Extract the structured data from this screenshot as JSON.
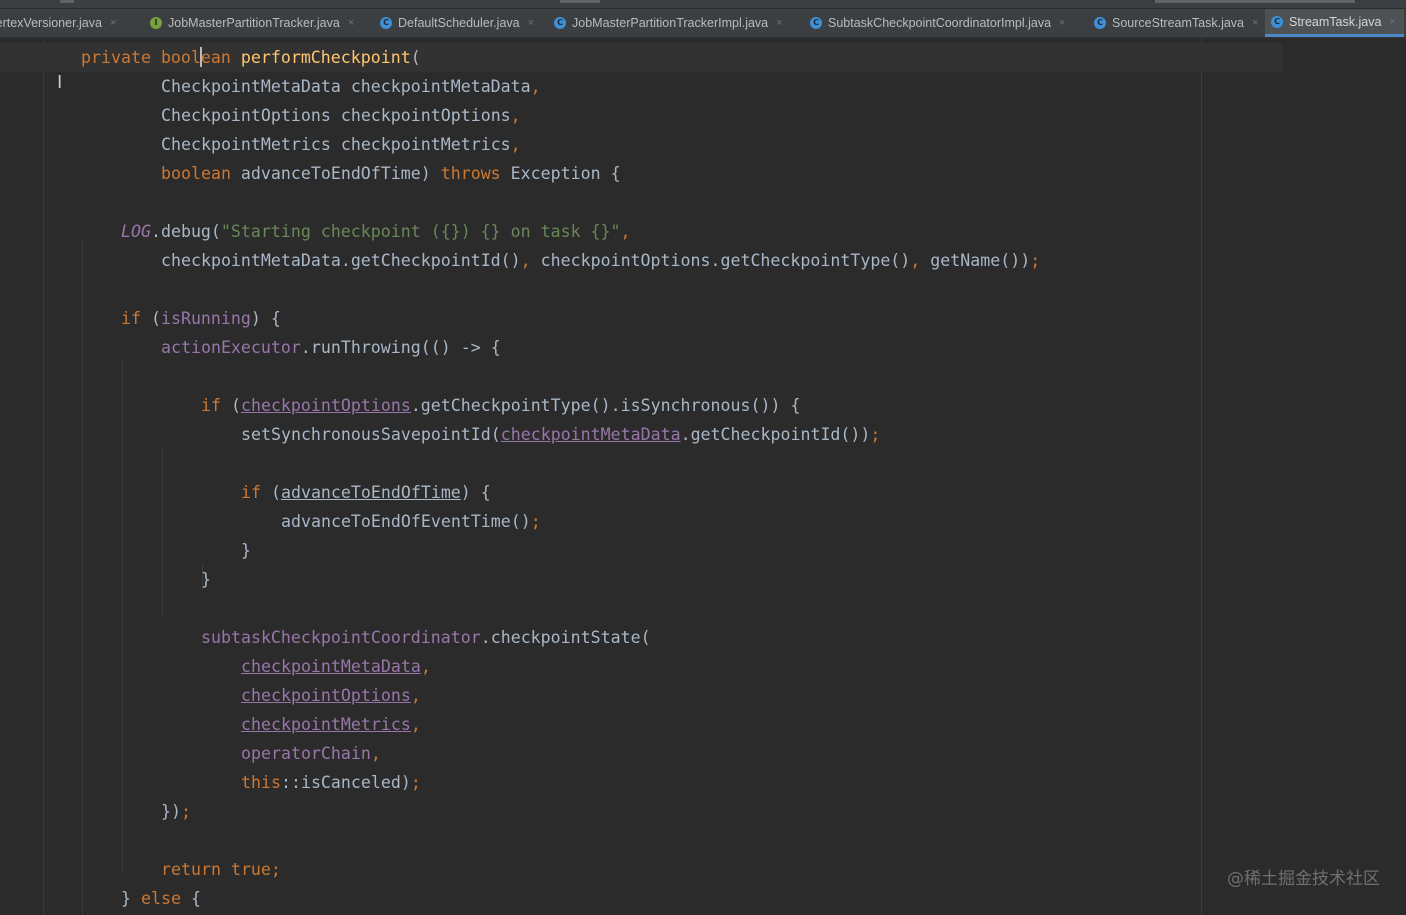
{
  "tabs": [
    {
      "label": "VertexVersioner.java",
      "icon": "class-icon",
      "active": false
    },
    {
      "label": "JobMasterPartitionTracker.java",
      "icon": "interface-icon",
      "active": false
    },
    {
      "label": "DefaultScheduler.java",
      "icon": "class-icon",
      "active": false
    },
    {
      "label": "JobMasterPartitionTrackerImpl.java",
      "icon": "class-icon",
      "active": false
    },
    {
      "label": "SubtaskCheckpointCoordinatorImpl.java",
      "icon": "class-icon",
      "active": false
    },
    {
      "label": "SourceStreamTask.java",
      "icon": "class-icon",
      "active": false
    },
    {
      "label": "StreamTask.java",
      "icon": "class-icon",
      "active": true
    }
  ],
  "tab_close_glyph": "×",
  "watermark": "@稀土掘金技术社区",
  "colors": {
    "keyword": "#cc7832",
    "method_decl": "#ffc66d",
    "string": "#6a8759",
    "field": "#9876aa",
    "plain": "#a9b7c6",
    "background": "#2b2b2b",
    "active_tab_underline": "#4a88c7"
  },
  "code_lines": [
    {
      "indent": 1,
      "tokens": [
        [
          "private",
          "kw"
        ],
        [
          " ",
          "pl"
        ],
        [
          "boolean",
          "kw"
        ],
        [
          " ",
          "pl"
        ],
        [
          "performCheckpoint",
          "fn"
        ],
        [
          "(",
          "pl"
        ]
      ]
    },
    {
      "indent": 3,
      "tokens": [
        [
          "CheckpointMetaData",
          "pl"
        ],
        [
          " checkpointMetaData",
          "pl"
        ],
        [
          ",",
          "pu"
        ]
      ]
    },
    {
      "indent": 3,
      "tokens": [
        [
          "CheckpointOptions",
          "pl"
        ],
        [
          " checkpointOptions",
          "pl"
        ],
        [
          ",",
          "pu"
        ]
      ]
    },
    {
      "indent": 3,
      "tokens": [
        [
          "CheckpointMetrics",
          "pl"
        ],
        [
          " checkpointMetrics",
          "pl"
        ],
        [
          ",",
          "pu"
        ]
      ]
    },
    {
      "indent": 3,
      "tokens": [
        [
          "boolean",
          "kw"
        ],
        [
          " advanceToEndOfTime) ",
          "pl"
        ],
        [
          "throws",
          "kw"
        ],
        [
          " Exception {",
          "pl"
        ]
      ]
    },
    {
      "indent": 0,
      "tokens": []
    },
    {
      "indent": 2,
      "tokens": [
        [
          "LOG",
          "logc"
        ],
        [
          ".debug(",
          "pl"
        ],
        [
          "\"Starting checkpoint ({}) {} on task {}\"",
          "str"
        ],
        [
          ",",
          "pu"
        ]
      ]
    },
    {
      "indent": 3,
      "tokens": [
        [
          "checkpointMetaData.getCheckpointId()",
          "pl"
        ],
        [
          ",",
          "pu"
        ],
        [
          " checkpointOptions.getCheckpointType()",
          "pl"
        ],
        [
          ",",
          "pu"
        ],
        [
          " getName())",
          "pl"
        ],
        [
          ";",
          "pu"
        ]
      ]
    },
    {
      "indent": 0,
      "tokens": []
    },
    {
      "indent": 2,
      "tokens": [
        [
          "if",
          "kw"
        ],
        [
          " (",
          "pl"
        ],
        [
          "isRunning",
          "field"
        ],
        [
          ") {",
          "pl"
        ]
      ]
    },
    {
      "indent": 3,
      "tokens": [
        [
          "actionExecutor",
          "field"
        ],
        [
          ".runThrowing(() -> {",
          "pl"
        ]
      ]
    },
    {
      "indent": 0,
      "tokens": []
    },
    {
      "indent": 4,
      "tokens": [
        [
          "if",
          "kw"
        ],
        [
          " (",
          "pl"
        ],
        [
          "checkpointOptions",
          "field u"
        ],
        [
          ".getCheckpointType().isSynchronous()) {",
          "pl"
        ]
      ]
    },
    {
      "indent": 5,
      "tokens": [
        [
          "setSynchronousSavepointId(",
          "pl"
        ],
        [
          "checkpointMetaData",
          "field u"
        ],
        [
          ".getCheckpointId())",
          "pl"
        ],
        [
          ";",
          "pu"
        ]
      ]
    },
    {
      "indent": 0,
      "tokens": []
    },
    {
      "indent": 5,
      "tokens": [
        [
          "if",
          "kw"
        ],
        [
          " (",
          "pl"
        ],
        [
          "advanceToEndOfTime",
          "pv"
        ],
        [
          ") {",
          "pl"
        ]
      ]
    },
    {
      "indent": 6,
      "tokens": [
        [
          "advanceToEndOfEventTime()",
          "pl"
        ],
        [
          ";",
          "pu"
        ]
      ]
    },
    {
      "indent": 5,
      "tokens": [
        [
          "}",
          "pl"
        ]
      ]
    },
    {
      "indent": 4,
      "tokens": [
        [
          "}",
          "pl"
        ]
      ]
    },
    {
      "indent": 0,
      "tokens": []
    },
    {
      "indent": 4,
      "tokens": [
        [
          "subtaskCheckpointCoordinator",
          "field"
        ],
        [
          ".checkpointState(",
          "pl"
        ]
      ]
    },
    {
      "indent": 5,
      "tokens": [
        [
          "checkpointMetaData",
          "field u"
        ],
        [
          ",",
          "pu"
        ]
      ]
    },
    {
      "indent": 5,
      "tokens": [
        [
          "checkpointOptions",
          "field u"
        ],
        [
          ",",
          "pu"
        ]
      ]
    },
    {
      "indent": 5,
      "tokens": [
        [
          "checkpointMetrics",
          "field u"
        ],
        [
          ",",
          "pu"
        ]
      ]
    },
    {
      "indent": 5,
      "tokens": [
        [
          "operatorChain",
          "field"
        ],
        [
          ",",
          "pu"
        ]
      ]
    },
    {
      "indent": 5,
      "tokens": [
        [
          "this",
          "kw"
        ],
        [
          "::isCanceled)",
          "pl"
        ],
        [
          ";",
          "pu"
        ]
      ]
    },
    {
      "indent": 3,
      "tokens": [
        [
          "})",
          "pl"
        ],
        [
          ";",
          "pu"
        ]
      ]
    },
    {
      "indent": 0,
      "tokens": []
    },
    {
      "indent": 3,
      "tokens": [
        [
          "return",
          "kw"
        ],
        [
          " ",
          "pl"
        ],
        [
          "true",
          "kw"
        ],
        [
          ";",
          "pu"
        ]
      ]
    },
    {
      "indent": 2,
      "tokens": [
        [
          "}",
          "pl"
        ],
        [
          " ",
          "pl"
        ],
        [
          "else",
          "kw"
        ],
        [
          " {",
          "pl"
        ]
      ]
    }
  ]
}
